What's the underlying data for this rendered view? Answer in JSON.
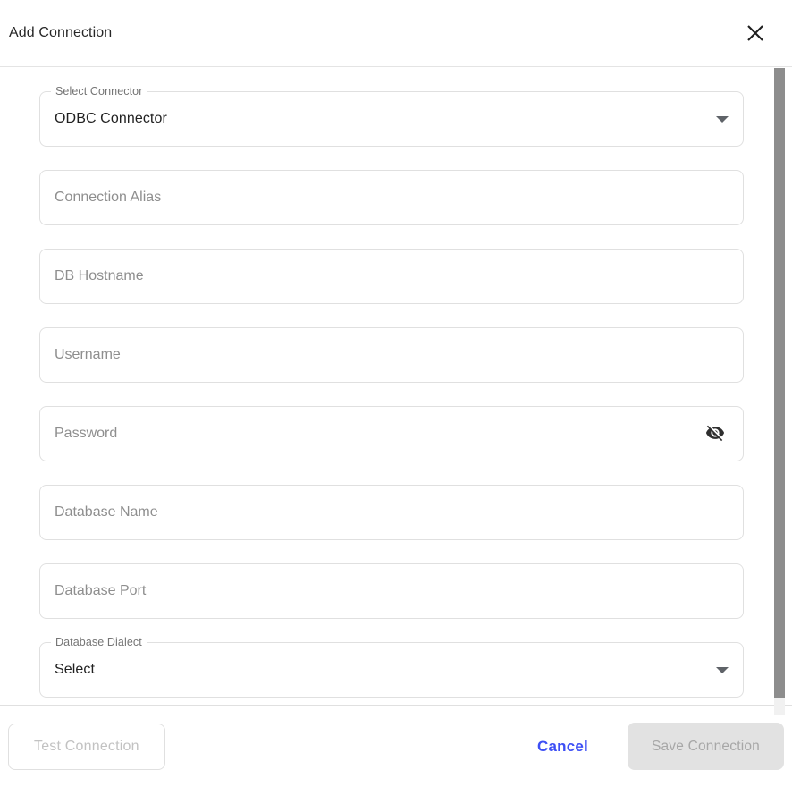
{
  "dialog": {
    "title": "Add Connection"
  },
  "form": {
    "connector_select": {
      "label": "Select Connector",
      "value": "ODBC Connector"
    },
    "fields": {
      "alias": {
        "placeholder": "Connection Alias"
      },
      "hostname": {
        "placeholder": "DB Hostname"
      },
      "username": {
        "placeholder": "Username"
      },
      "password": {
        "placeholder": "Password"
      },
      "db_name": {
        "placeholder": "Database Name"
      },
      "db_port": {
        "placeholder": "Database Port"
      }
    },
    "dialect_select": {
      "label": "Database Dialect",
      "value": "Select"
    }
  },
  "footer": {
    "test_label": "Test Connection",
    "cancel_label": "Cancel",
    "save_label": "Save Connection"
  },
  "icons": {
    "close": "close-x",
    "dropdown": "caret-down",
    "password_visibility": "visibility-off"
  },
  "colors": {
    "accent_blue": "#3d4ff5",
    "field_border": "#e0e0e0",
    "placeholder_text": "#8e8e8e",
    "value_text": "#212121",
    "disabled_button_bg": "#e2e2e2",
    "disabled_button_text": "#a7a7a7",
    "scrollbar_thumb": "#8d8d8d"
  }
}
